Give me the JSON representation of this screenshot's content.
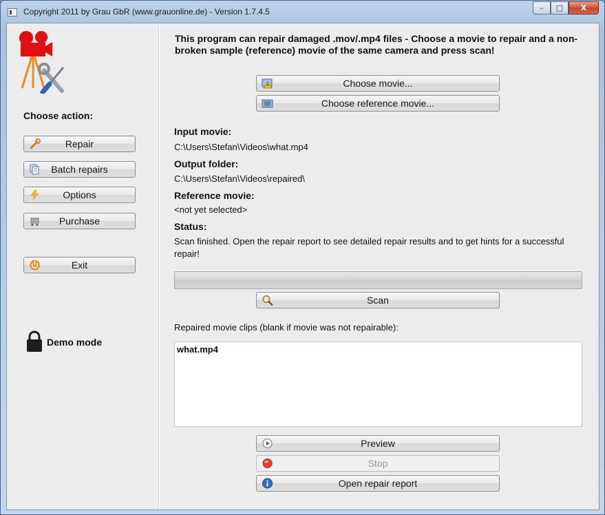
{
  "window": {
    "title": "Copyright 2011 by Grau GbR (www.grauonline.de) - Version 1.7.4.5",
    "controls": {
      "minimize": "–",
      "maximize": "□",
      "close": "X"
    }
  },
  "sidebar": {
    "heading": "Choose action:",
    "buttons": {
      "repair": "Repair",
      "batch": "Batch repairs",
      "options": "Options",
      "purchase": "Purchase",
      "exit": "Exit"
    },
    "mode": "Demo mode"
  },
  "main": {
    "intro": "This program can repair damaged .mov/.mp4 files - Choose a movie to repair and a non-broken sample (reference) movie of the same camera and press scan!",
    "choose_movie": "Choose movie...",
    "choose_reference": "Choose reference movie...",
    "input_label": "Input movie:",
    "input_value": "C:\\Users\\Stefan\\Videos\\what.mp4",
    "output_label": "Output folder:",
    "output_value": "C:\\Users\\Stefan\\Videos\\repaired\\",
    "reference_label": "Reference movie:",
    "reference_value": "<not yet selected>",
    "status_label": "Status:",
    "status_value": "Scan finished. Open the repair report to see detailed repair results and to get hints for a successful repair!",
    "progress": 0,
    "scan": "Scan",
    "clips_label": "Repaired movie clips (blank if movie was not repairable):",
    "clips": [
      "what.mp4"
    ],
    "preview": "Preview",
    "stop": "Stop",
    "stop_disabled": true,
    "open_report": "Open repair report"
  }
}
